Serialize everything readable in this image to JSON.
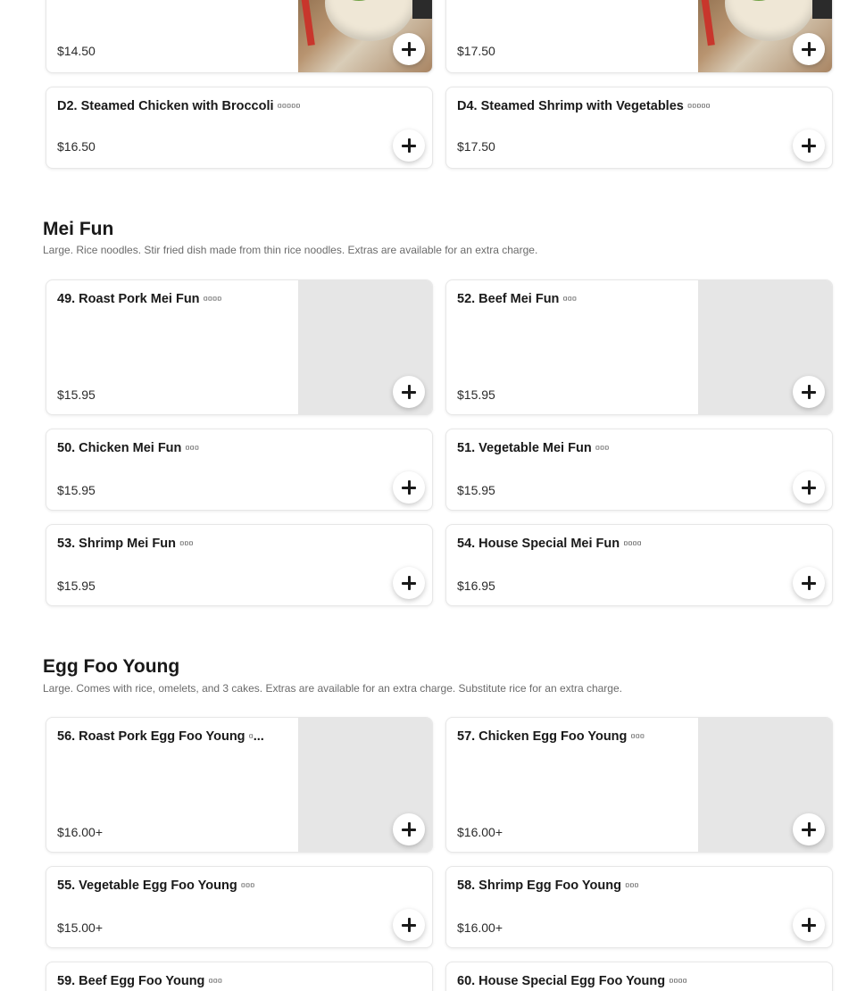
{
  "top_cards": [
    {
      "price": "$14.50"
    },
    {
      "price": "$17.50"
    }
  ],
  "diet_cards": [
    {
      "name": "D2. Steamed Chicken with Broccoli ▫▫▫▫▫",
      "price": "$16.50"
    },
    {
      "name": "D4. Steamed Shrimp with Vegetables ▫▫▫▫▫",
      "price": "$17.50"
    }
  ],
  "mei_fun": {
    "title": "Mei Fun",
    "description": "Large. Rice noodles. Stir fried dish made from thin rice noodles. Extras are available for an extra charge.",
    "items": [
      {
        "name": "49. Roast Pork Mei Fun ▫▫▫▫",
        "price": "$15.95"
      },
      {
        "name": "52. Beef Mei Fun ▫▫▫",
        "price": "$15.95"
      },
      {
        "name": "50. Chicken Mei Fun ▫▫▫",
        "price": "$15.95"
      },
      {
        "name": "51. Vegetable Mei Fun ▫▫▫",
        "price": "$15.95"
      },
      {
        "name": "53. Shrimp Mei Fun ▫▫▫",
        "price": "$15.95"
      },
      {
        "name": "54. House Special Mei Fun ▫▫▫▫",
        "price": "$16.95"
      }
    ]
  },
  "egg_foo_young": {
    "title": "Egg Foo Young",
    "description": "Large. Comes with rice, omelets, and 3 cakes. Extras are available for an extra charge. Substitute rice for an extra charge.",
    "items": [
      {
        "name": "56. Roast Pork Egg Foo Young ▫...",
        "price": "$16.00+"
      },
      {
        "name": "57. Chicken Egg Foo Young ▫▫▫",
        "price": "$16.00+"
      },
      {
        "name": "55. Vegetable Egg Foo Young ▫▫▫",
        "price": "$15.00+"
      },
      {
        "name": "58. Shrimp Egg Foo Young ▫▫▫",
        "price": "$16.00+"
      },
      {
        "name": "59. Beef Egg Foo Young ▫▫▫",
        "price": ""
      },
      {
        "name": "60. House Special Egg Foo Young ▫▫▫▫",
        "price": ""
      }
    ]
  },
  "icons": {
    "add": "plus-icon"
  },
  "colors": {
    "card_border": "#e7e7e7",
    "photo_placeholder": "#e6e6e6",
    "text": "#191919"
  }
}
